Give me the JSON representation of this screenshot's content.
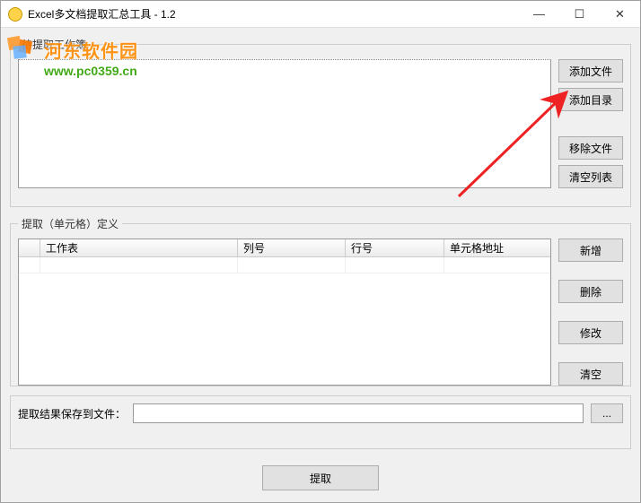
{
  "window": {
    "title": "Excel多文档提取汇总工具 - 1.2"
  },
  "watermark": {
    "text": "河东软件园",
    "url": "www.pc0359.cn"
  },
  "workbooks": {
    "legend": "待提取工作簿",
    "buttons": {
      "add_file": "添加文件",
      "add_dir": "添加目录",
      "remove_file": "移除文件",
      "clear_list": "清空列表"
    }
  },
  "defs": {
    "legend": "提取（单元格）定义",
    "columns": {
      "worksheet": "工作表",
      "col": "列号",
      "row": "行号",
      "addr": "单元格地址"
    },
    "buttons": {
      "add": "新增",
      "del": "删除",
      "edit": "修改",
      "clear": "清空"
    }
  },
  "output": {
    "label": "提取结果保存到文件：",
    "browse": "..."
  },
  "actions": {
    "extract": "提取"
  },
  "winctrl": {
    "min": "—",
    "max": "☐",
    "close": "✕"
  }
}
